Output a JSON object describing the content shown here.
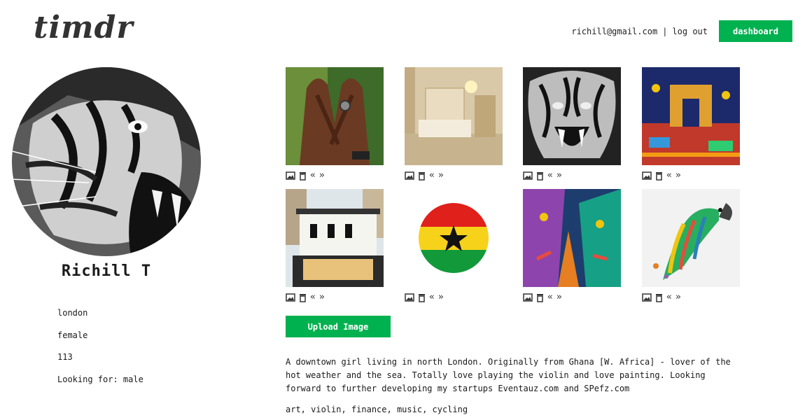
{
  "header": {
    "logo": "timdr",
    "user_email": "richill@gmail.com",
    "separator": "|",
    "logout_label": "log out",
    "dashboard_label": "dashboard"
  },
  "profile": {
    "avatar_icon": "tiger-photo",
    "name": "Richill T",
    "location": "london",
    "gender": "female",
    "number": "113",
    "looking_for": "Looking for: male"
  },
  "gallery": {
    "images": [
      {
        "subject": "hands-with-ring"
      },
      {
        "subject": "bedroom-interior"
      },
      {
        "subject": "roaring-tiger"
      },
      {
        "subject": "arc-de-triomphe-painting"
      },
      {
        "subject": "modern-house"
      },
      {
        "subject": "ghana-flag-football"
      },
      {
        "subject": "street-painting"
      },
      {
        "subject": "colorful-parrot"
      }
    ],
    "action_icons": [
      "image-icon",
      "trash-icon",
      "move-left-icon",
      "move-right-icon"
    ],
    "upload_label": "Upload Image"
  },
  "about": {
    "bio": "A downtown girl living in north London. Originally from Ghana [W. Africa] - lover of the hot weather and the sea. Totally love playing the violin and love painting. Looking forward to further developing my startups Eventauz.com and SPefz.com",
    "interests": "art, violin, finance, music, cycling"
  },
  "colors": {
    "accent": "#00b14f",
    "text": "#1a1a1a"
  }
}
